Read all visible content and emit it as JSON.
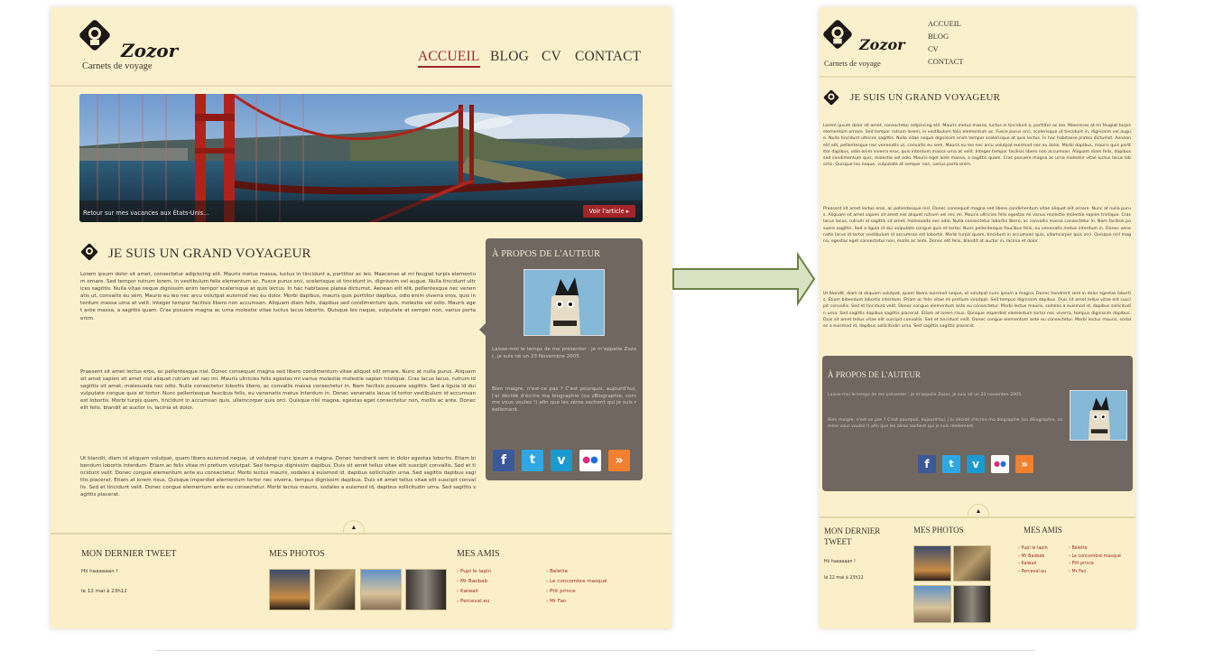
{
  "site": {
    "logo_name": "Zozor",
    "tagline": "Carnets de voyage"
  },
  "nav": {
    "items": [
      "ACCUEIL",
      "BLOG",
      "CV",
      "CONTACT"
    ],
    "active": "ACCUEIL"
  },
  "hero": {
    "caption": "Retour sur mes vacances aux États-Unis...",
    "button": "Voir l'article ▸"
  },
  "article": {
    "title": "JE SUIS UN GRAND VOYAGEUR",
    "paragraphs": [
      "Lorem ipsum dolor sit amet, consectetur adipiscing elit. Mauris metus massa, luctus in tincidunt a, porttitor ac leo. Maecenas at mi feugiat turpis elementum ornare. Sed tempor rutrum lorem, in vestibulum felis elementum ac. Fusce purus orci, scelerisque ut tincidunt in, dignissim vel augue. Nulla tincidunt ultrices sagittis. Nulla vitae neque dignissim enim tempor scelerisque at quis lectus. In hac habitasse platea dictumst. Aenean elit elit, pellentesque nec venenatis ut, convallis eu sem. Mauris eu leo nec arcu volutpat euismod nec eu dolor. Morbi dapibus, mauris quis porttitor dapibus, odio enim viverra eros, quis interdum massa urna at velit. Integer tempor facilisis libero non accumsan. Aliquam diam felis, dapibus sed condimentum quis, molestie vel odio. Mauris eget ante massa, a sagittis quam. Cras posuere magna ac urna molestie vitae luctus lacus lobortis. Quisque leo neque, vulputate at semper non, varius porta enim.",
      "Praesent sit amet lectus eros, ac pellentesque nisl. Donec consequat magna sed libero condimentum vitae aliquet elit ornare. Nunc at nulla purus. Aliquam sit amet sapien sit amet nisl aliquet rutrum vel nec mi. Mauris ultricies felis egestas mi varius molestie molestie sapien tristique. Cras lacus lacus, rutrum id sagittis sit amet, malesuada nec odio. Nulla consectetur lobortis libero, ac convallis massa consectetur in. Nam facilisis posuere sagittis. Sed a ligula id dui vulputate congue quis et tortor. Nunc pellentesque faucibus felis, eu venenatis metus interdum in. Donec venenatis lacus id tortor vestibulum id accumsan est lobortis. Morbi turpis quam, tincidunt in accumsan quis, ullamcorper quis orci. Quisque nisl magna, egestas eget consectetur non, mollis ac ante. Donec elit felis, blandit at auctor in, lacinia et dolor.",
      "Ut blandit, diam id aliquam volutpat, quam libero euismod neque, ut volutpat nunc ipsum a magna. Donec hendrerit sem in dolor egestas lobortis. Etiam bibendum lobortis interdum. Etiam ac felis vitae mi pretium volutpat. Sed tempus dignissim dapibus. Duis sit amet tellus vitae elit suscipit convallis. Sed et tincidunt velit. Donec congue elementum ante eu consectetur. Morbi lectus mauris, sodales a euismod id, dapibus sollicitudin urna. Sed sagittis dapibus sagittis placerat. Etiam at lorem risus. Quisque imperdiet elementum tortor nec viverra, tempus dignissim dapibus. Duis sit amet tellus vitae elit suscipit convallis. Sed et tincidunt velit. Donec congue elementum ante eu consectetur. Morbi lectus mauris, sodales a euismod id, dapibus sollicitudin urna. Sed sagittis sagittis placerat."
    ]
  },
  "about": {
    "title": "À PROPOS DE L'AUTEUR",
    "desktop_text": [
      "Laisse-moi le temps de me présenter : je m'appelle Zozor, je suis né un 23 Novembre 2005.",
      "Bien maigre, n'est-ce pas ? C'est pourquoi, aujourd'hui, j'ai décidé d'écrire ma biographie (ou zBiographie, comme vous voulez !) afin que les zéros sachent qui je suis réellement."
    ],
    "mobile_text": [
      "Laisse-moi le temps de me présenter : je m'appelle Zozor, je suis né un 23 novembre 2005.",
      "Bien maigre, n'est-ce pas ? C'est pourquoi, aujourd'hui, j'ai décidé d'écrire ma biographie (ou zBiographie, comme vous voulez !) afin que les zéros sachent qui je suis réellement."
    ],
    "social": [
      {
        "icon": "facebook-icon",
        "glyph": "f",
        "color": "#3b5998"
      },
      {
        "icon": "twitter-icon",
        "glyph": "t",
        "color": "#2ea8e5"
      },
      {
        "icon": "vimeo-icon",
        "glyph": "v",
        "color": "#1a9ad0"
      },
      {
        "icon": "flickr-icon",
        "glyph": "••",
        "color": "#ffffff"
      },
      {
        "icon": "rss-icon",
        "glyph": "»",
        "color": "#f2802e"
      }
    ]
  },
  "footer": {
    "tweet_title": "MON DERNIER TWEET",
    "tweet_text": "Hii haaaaaan !",
    "tweet_date": "le 12 mai à 23h12",
    "photos_title": "MES PHOTOS",
    "friends_title": "MES AMIS",
    "friends_col1": [
      "Pupi le lapin",
      "Mr Baobab",
      "Kaiwaii",
      "Perceval.eu"
    ],
    "friends_col2": [
      "Belette",
      "Le concombre masqué",
      "Ptit prince",
      "Mr Fan"
    ],
    "toggle": "▲"
  },
  "colors": {
    "page_bg": "#fbf0cc",
    "accent": "#9a2a24",
    "aside_bg": "#6f6760",
    "arrow_fill": "#d9e2c3",
    "arrow_stroke": "#6b8046"
  }
}
